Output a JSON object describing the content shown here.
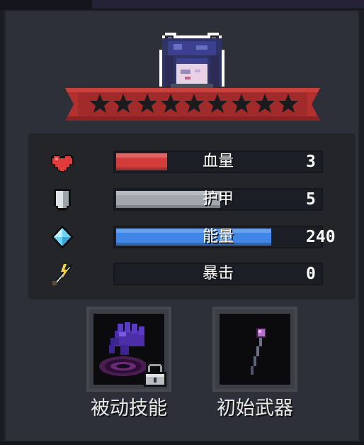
{
  "character": {
    "rarity_stars": 9,
    "portrait_icon": "horned-vampire-portrait"
  },
  "stats": [
    {
      "key": "hp",
      "label": "血量",
      "value": "3",
      "fill": 0.25,
      "color": "#d43c3c",
      "icon": "heart-icon"
    },
    {
      "key": "armor",
      "label": "护甲",
      "value": "5",
      "fill": 0.51,
      "color": "#a0a8ae",
      "icon": "shield-icon"
    },
    {
      "key": "energy",
      "label": "能量",
      "value": "240",
      "fill": 0.76,
      "color": "#3f86e6",
      "icon": "diamond-icon"
    },
    {
      "key": "crit",
      "label": "暴击",
      "value": "0",
      "fill": 0.0,
      "color": "#d9b43a",
      "icon": "lightning-sword-icon"
    }
  ],
  "slots": {
    "passive_skill": {
      "label": "被动技能",
      "icon": "purple-hand-vortex-icon",
      "locked": true
    },
    "starting_weapon": {
      "label": "初始武器",
      "icon": "purple-orb-staff-icon"
    }
  },
  "colors": {
    "panel": "#2d3038",
    "ribbon": "#b3302f",
    "star": "#1b1a1d",
    "background": "#1b1d24"
  }
}
